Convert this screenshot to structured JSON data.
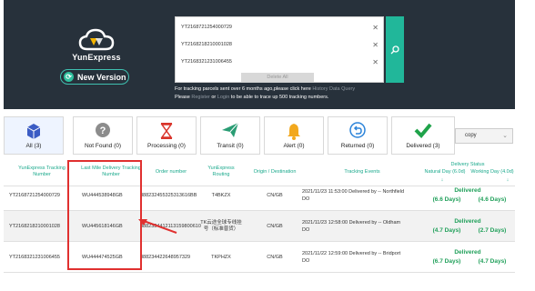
{
  "header": {
    "brand": "YunExpress",
    "new_version": "New Version",
    "tracking_numbers": [
      "YT2168721254000729",
      "YT2168218210001028",
      "YT2168321231006455"
    ],
    "delete_all": "Delete All",
    "note_line1_a": "For tracking parcels sent over 6 months ago,please click here ",
    "note_line1_link": "History Data Query",
    "note_line2_a": "Please ",
    "note_line2_link1": "Register",
    "note_line2_b": " or ",
    "note_line2_link2": "Login",
    "note_line2_c": " to be able to trace up 500 tracking numbers."
  },
  "statuses": [
    {
      "label": "All (3)",
      "icon": "box-icon"
    },
    {
      "label": "Not Found (0)",
      "icon": "question-icon"
    },
    {
      "label": "Processing (0)",
      "icon": "hourglass-icon"
    },
    {
      "label": "Transit (0)",
      "icon": "paper-plane-icon"
    },
    {
      "label": "Alert (0)",
      "icon": "bell-icon"
    },
    {
      "label": "Returned (0)",
      "icon": "return-icon"
    },
    {
      "label": "Delivered (3)",
      "icon": "check-icon"
    }
  ],
  "copy_select": "copy",
  "columns": {
    "yunexpress_tracking": "YunExpress Tracking Number",
    "last_mile": "Last Mile Delivery Tracking Number",
    "order": "Order number",
    "routing": "YunExpress Routing",
    "origin_dest": "Origin / Destination",
    "events": "Tracking Events",
    "delivery_status": "Delivery Status",
    "natural_day": "Natural Day (6.0d)",
    "working_day": "Working Day (4.0d)"
  },
  "rows": [
    {
      "tracking": "YT2168721254000729",
      "last_mile": "WU444538948GB",
      "order": "888232455325313616BB",
      "routing": "T4BKZX",
      "od": "CN/GB",
      "event": "2021/11/23 11:53:00 Delivered by -- Northfield",
      "event2": "DO",
      "status": "Delivered",
      "natural": "(6.6 Days)",
      "working": "(4.6 Days)"
    },
    {
      "tracking": "YT2168218210001028",
      "last_mile": "WU445618146GB",
      "order": "8882334412113159800610",
      "routing": "TK云途全球专线挂号（标准普货）",
      "od": "CN/GB",
      "event": "2021/11/23 12:58:00 Delivered by -- Oldham",
      "event2": "DO",
      "status": "Delivered",
      "natural": "(4.7 Days)",
      "working": "(2.7 Days)"
    },
    {
      "tracking": "YT2168321231006455",
      "last_mile": "WU444474525GB",
      "order": "888234422648957329",
      "routing": "TKPHZX",
      "od": "CN/GB",
      "event": "2021/11/22 12:59:00 Delivered by -- Bridport",
      "event2": "DO",
      "status": "Delivered",
      "natural": "(6.7 Days)",
      "working": "(4.7 Days)"
    }
  ]
}
